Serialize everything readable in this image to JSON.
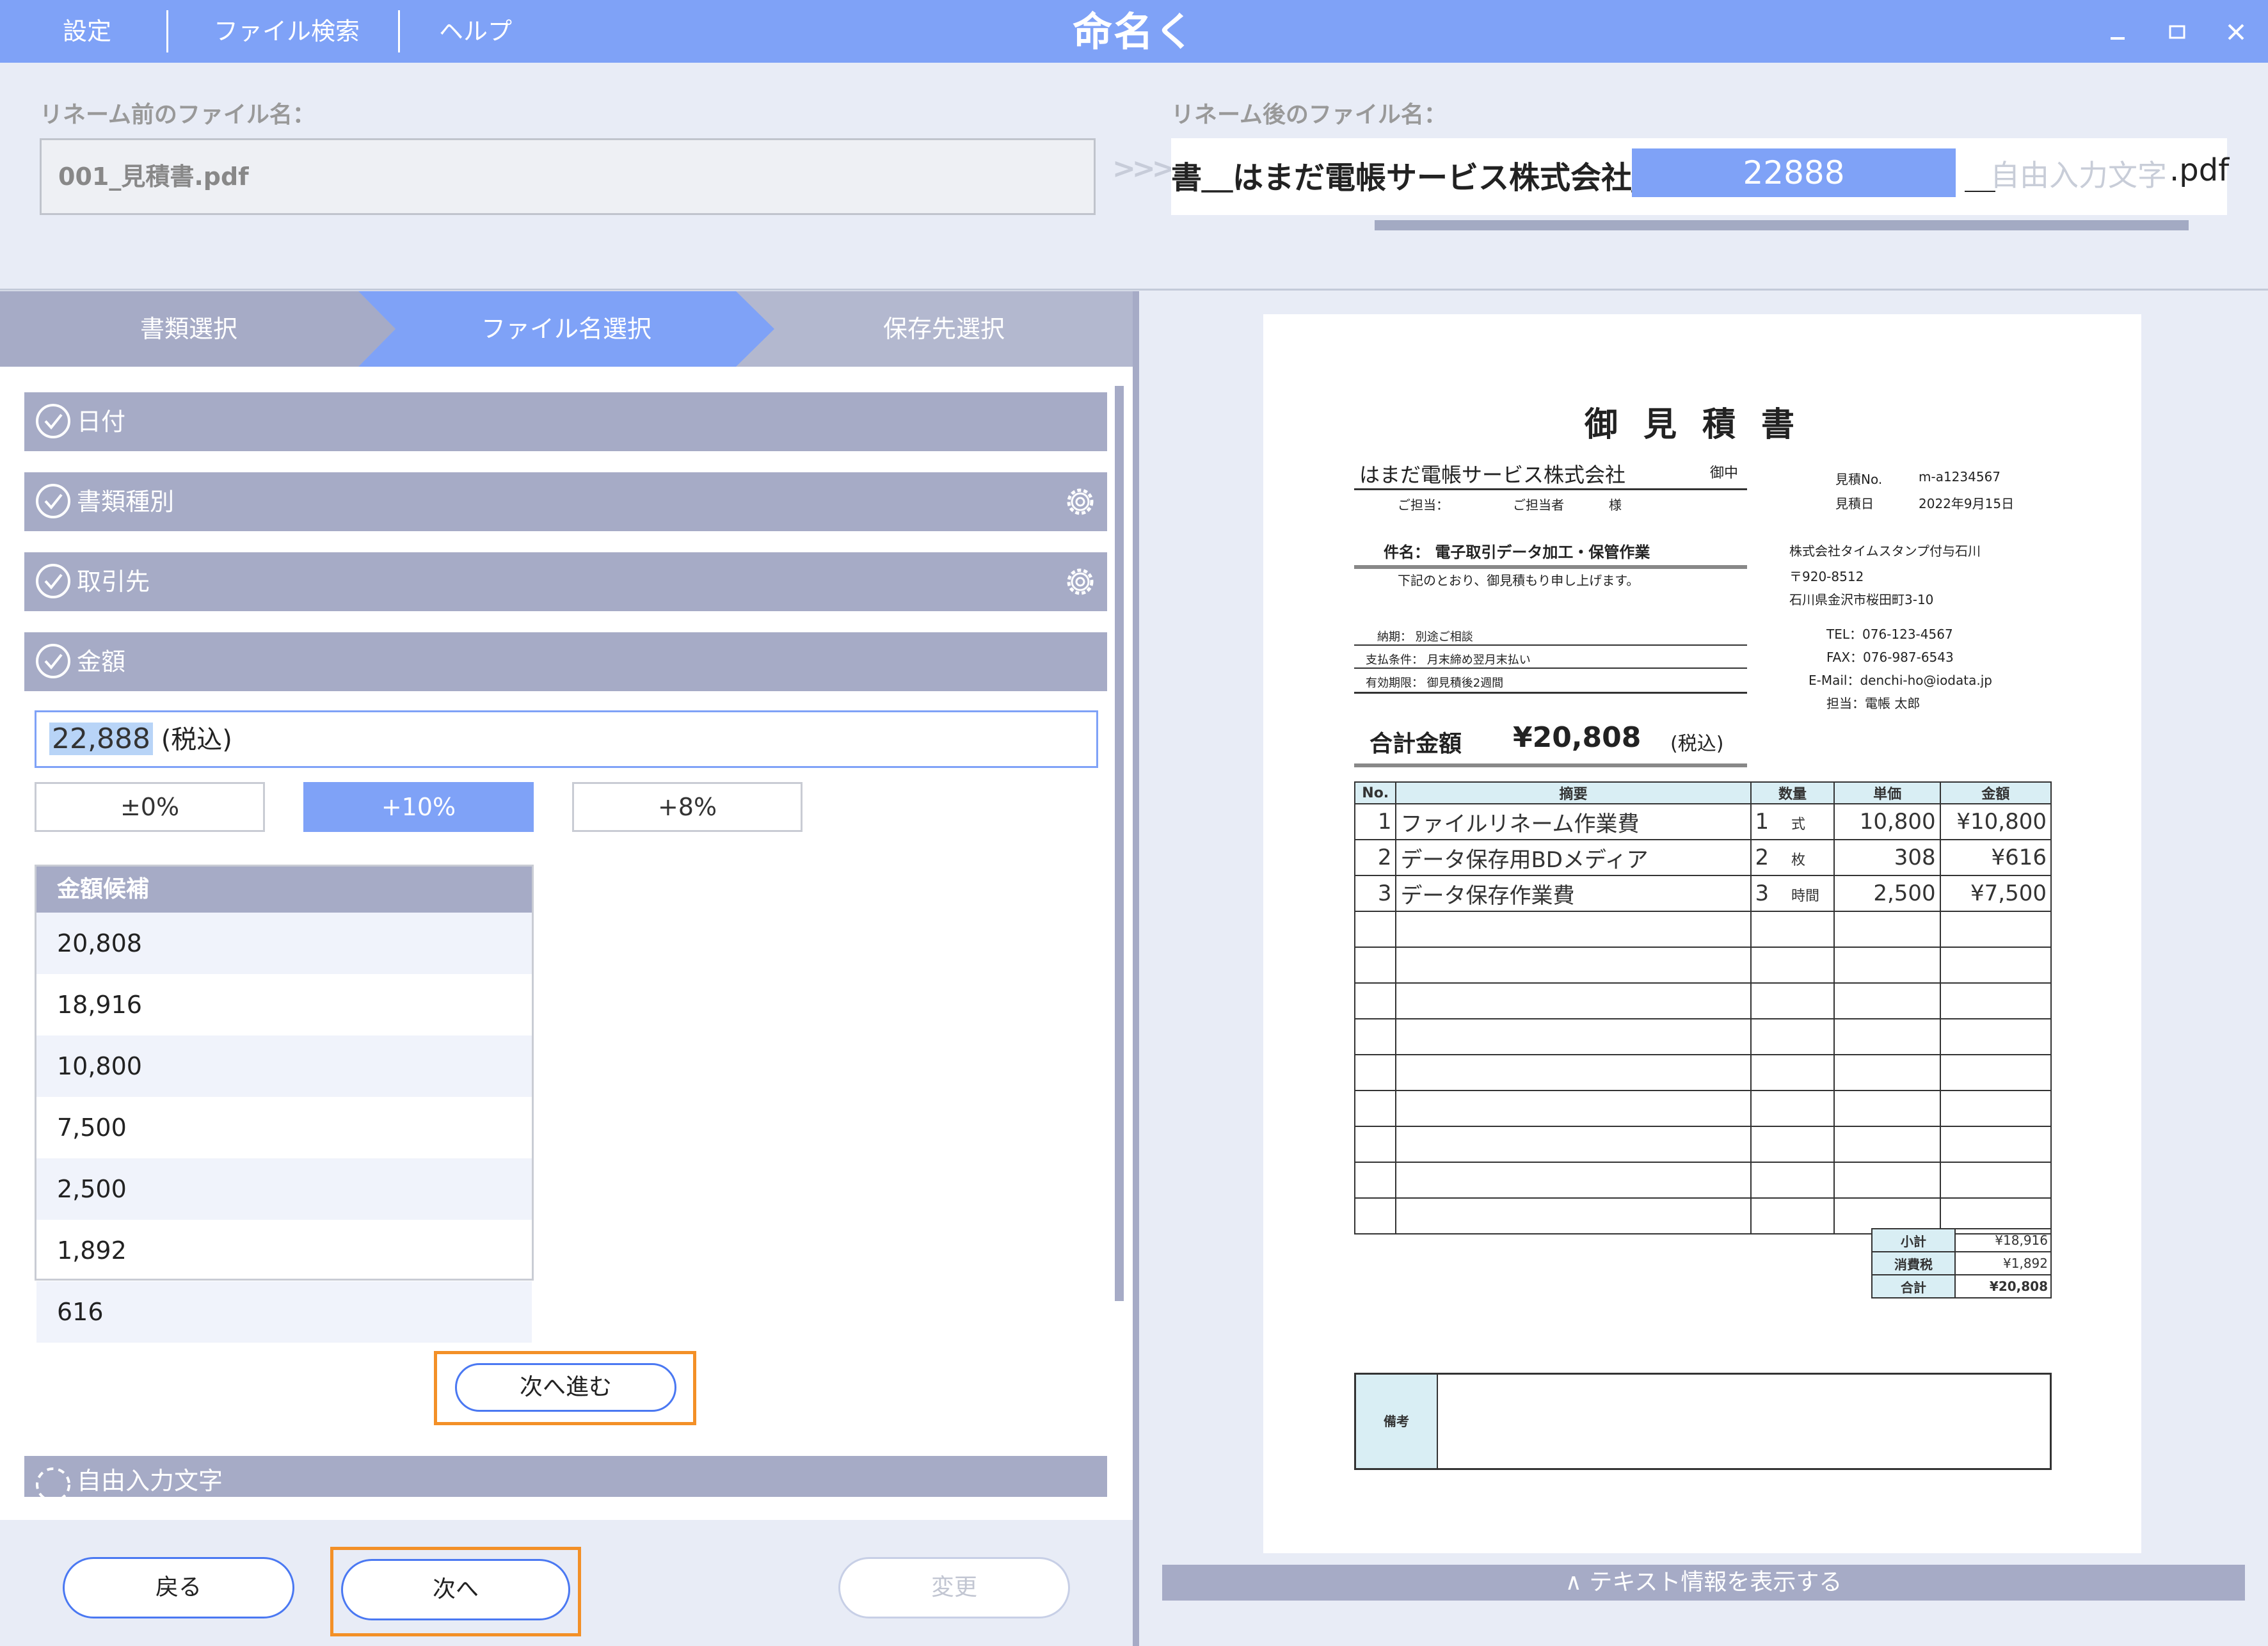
{
  "titlebar": {
    "menu": [
      "設定",
      "ファイル検索",
      "ヘルプ"
    ],
    "app_name": "命名くん",
    "colors": {
      "accent": "#7fa2f7",
      "highlight": "#f39027",
      "section": "#a6abc6"
    }
  },
  "rename": {
    "before_label": "リネーム前のファイル名：",
    "before_value": "001_見積書.pdf",
    "after_label": "リネーム後のファイル名：",
    "after_prefix": "書＿はまだ電帳サービス株式会社＿",
    "after_amount": "22888",
    "after_sep": "＿",
    "after_free": "自由入力文字",
    "after_ext": ".pdf"
  },
  "steps": [
    "書類選択",
    "ファイル名選択",
    "保存先選択"
  ],
  "sections": {
    "date": "日付",
    "doc_type": "書類種別",
    "client": "取引先",
    "amount": "金額",
    "free_text": "自由入力文字"
  },
  "amount": {
    "value": "22,888",
    "suffix": "(税込)",
    "tax_buttons": [
      "±0%",
      "+10%",
      "+8%"
    ],
    "candidates_header": "金額候補",
    "candidates": [
      "20,808",
      "18,916",
      "10,800",
      "7,500",
      "2,500",
      "1,892",
      "616"
    ],
    "next_step": "次へ進む"
  },
  "footer": {
    "back": "戻る",
    "next": "次へ",
    "change": "変更"
  },
  "preview": {
    "toggle_label": "∧ テキスト情報を表示する",
    "doc": {
      "title": "御見積書",
      "client": "はまだ電帳サービス株式会社",
      "onchu": "御中",
      "tanto_label": "ご担当：",
      "tanto_value": "ご担当者",
      "sama": "様",
      "estimate_no_label": "見積No.",
      "estimate_no": "m-a1234567",
      "estimate_date_label": "見積日",
      "estimate_date": "2022年9月15日",
      "subject": "件名： 電子取引データ加工・保管作業",
      "subject_note": "下記のとおり、御見積もり申し上げます。",
      "issuer": "株式会社タイムスタンプ付与石川",
      "zip": "〒920-8512",
      "address": "石川県金沢市桜田町3-10",
      "tel": "TEL：076-123-4567",
      "fax": "FAX：076-987-6543",
      "email": "E-Mail：denchi-ho@iodata.jp",
      "person": "担当：電帳 太郎",
      "delivery": "納期： 別途ご相談",
      "payment": "支払条件： 月末締め翌月末払い",
      "validity": "有効期限： 御見積後2週間",
      "total_label": "合計金額",
      "total_value": "¥20,808",
      "total_tax": "(税込)",
      "columns": [
        "No.",
        "摘要",
        "数量",
        "単価",
        "金額"
      ],
      "items": [
        {
          "no": "1",
          "desc": "ファイルリネーム作業費",
          "qty": "1",
          "unit": "式",
          "price": "10,800",
          "amount": "¥10,800"
        },
        {
          "no": "2",
          "desc": "データ保存用BDメディア",
          "qty": "2",
          "unit": "枚",
          "price": "308",
          "amount": "¥616"
        },
        {
          "no": "3",
          "desc": "データ保存作業費",
          "qty": "3",
          "unit": "時間",
          "price": "2,500",
          "amount": "¥7,500"
        }
      ],
      "subtotal_label": "小計",
      "subtotal": "¥18,916",
      "tax_label": "消費税",
      "tax": "¥1,892",
      "grand_label": "合計",
      "grand": "¥20,808",
      "remarks_label": "備考"
    }
  }
}
